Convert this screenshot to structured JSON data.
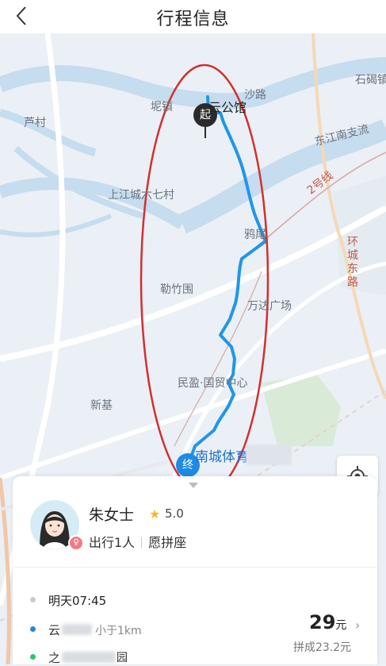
{
  "header": {
    "title": "行程信息"
  },
  "map": {
    "labels": {
      "shilong": "石碣镇",
      "yungong": "云公馆",
      "shalu": "沙路",
      "lucun": "芦村",
      "dongjiang": "东江南支流",
      "line2": "2号线",
      "shangjiang": "上江城六七村",
      "yawei": "鸦尾",
      "huancheng": "环城东路",
      "leizhuwei": "勒竹围",
      "wanda": "万达广场",
      "minying": "民盈·国贸中心",
      "xinji": "新基",
      "nancheng": "南城体育",
      "zhen": "坭镇",
      "shi": "石碣"
    },
    "start_marker": "起",
    "end_marker": "终"
  },
  "passenger": {
    "name": "朱女士",
    "rating": "5.0",
    "people": "出行1人",
    "carpool": "愿拼座",
    "gender_symbol": "♀"
  },
  "trip": {
    "time": "明天07:45",
    "start_distance": "小于1km",
    "end_tail": "园",
    "start_char": "云",
    "end_char": "之"
  },
  "fare": {
    "price": "29",
    "unit": "元",
    "share_label": "拼成23.2元"
  }
}
